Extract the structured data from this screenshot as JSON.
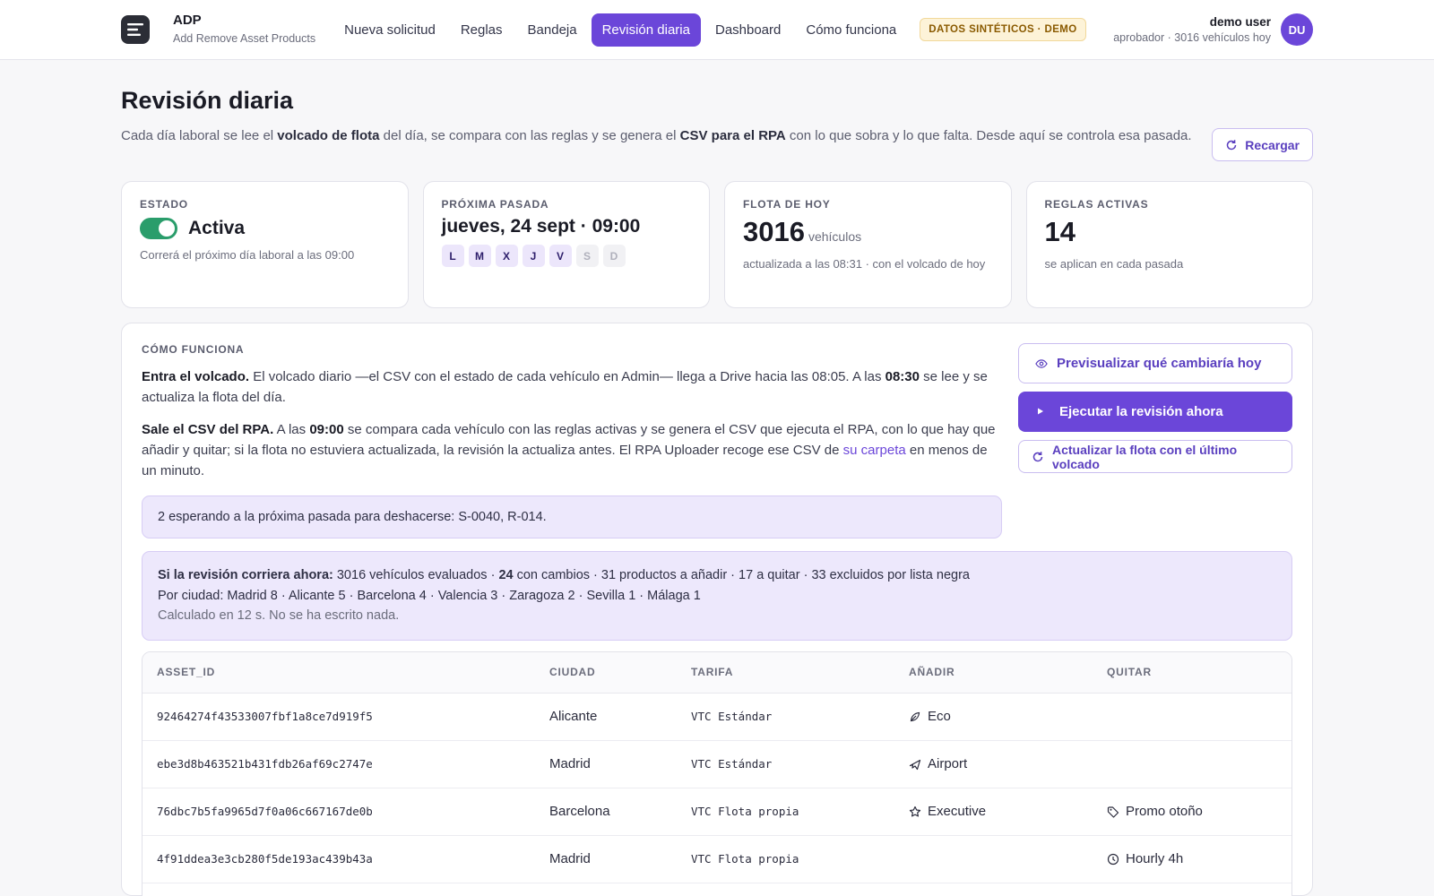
{
  "app": {
    "title": "ADP",
    "subtitle": "Add Remove Asset Products"
  },
  "nav": {
    "items": [
      {
        "label": "Nueva solicitud"
      },
      {
        "label": "Reglas"
      },
      {
        "label": "Bandeja"
      },
      {
        "label": "Revisión diaria",
        "active": true
      },
      {
        "label": "Dashboard"
      },
      {
        "label": "Cómo funciona"
      }
    ],
    "demo_badge": "DATOS SINTÉTICOS · DEMO"
  },
  "user": {
    "name": "demo user",
    "role": "aprobador · 3016 vehículos hoy",
    "initials": "DU"
  },
  "page": {
    "title": "Revisión diaria",
    "intro_1": "Cada día laboral se lee el ",
    "intro_b1": "volcado de flota",
    "intro_2": " del día, se compara con las reglas y se genera el ",
    "intro_b2": "CSV para el RPA",
    "intro_3": " con lo que sobra y lo que falta. Desde aquí se controla esa pasada.",
    "reload_label": "Recargar"
  },
  "cards": {
    "estado": {
      "label": "ESTADO",
      "value": "Activa",
      "sub": "Correrá el próximo día laboral a las 09:00"
    },
    "proxima": {
      "label": "PRÓXIMA PASADA",
      "value": "jueves, 24 sept · 09:00",
      "days": [
        {
          "d": "L",
          "on": true
        },
        {
          "d": "M",
          "on": true
        },
        {
          "d": "X",
          "on": true
        },
        {
          "d": "J",
          "on": true
        },
        {
          "d": "V",
          "on": true
        },
        {
          "d": "S",
          "on": false
        },
        {
          "d": "D",
          "on": false
        }
      ]
    },
    "flota": {
      "label": "FLOTA DE HOY",
      "value": "3016",
      "unit": "vehículos",
      "sub": "actualizada a las 08:31 · con el volcado de hoy"
    },
    "reglas": {
      "label": "REGLAS ACTIVAS",
      "value": "14",
      "sub": "se aplican en cada pasada"
    }
  },
  "how": {
    "label": "CÓMO FUNCIONA",
    "p1_b": "Entra el volcado.",
    "p1_a": " El volcado diario —el CSV con el estado de cada vehículo en Admin— llega a Drive hacia las 08:05. A las ",
    "p1_time": "08:30",
    "p1_c": " se lee y se actualiza la flota del día.",
    "p2_b": "Sale el CSV del RPA.",
    "p2_a": " A las ",
    "p2_time": "09:00",
    "p2_c": " se compara cada vehículo con las reglas activas y se genera el CSV que ejecuta el RPA, con lo que hay que añadir y quitar; si la flota no estuviera actualizada, la revisión la actualiza antes. El RPA Uploader recoge ese CSV de ",
    "p2_link": "su carpeta",
    "p2_d": " en menos de un minuto.",
    "pending": "2 esperando a la próxima pasada para deshacerse: S-0040, R-014.",
    "btn_preview": "Previsualizar qué cambiaría hoy",
    "btn_run": "Ejecutar la revisión ahora",
    "btn_update": "Actualizar la flota con el último volcado"
  },
  "preview": {
    "lead": "Si la revisión corriera ahora:",
    "line1_a": " 3016 vehículos evaluados · ",
    "line1_b": "24",
    "line1_c": " con cambios · 31 productos a añadir · 17 a quitar · 33 excluidos por lista negra",
    "line2": "Por ciudad: Madrid 8 · Alicante 5 · Barcelona 4 · Valencia 3 · Zaragoza 2 · Sevilla 1 · Málaga 1",
    "line3": "Calculado en 12 s. No se ha escrito nada."
  },
  "table": {
    "headers": [
      "ASSET_ID",
      "CIUDAD",
      "TARIFA",
      "AÑADIR",
      "QUITAR"
    ],
    "rows": [
      {
        "asset": "92464274f43533007fbf1a8ce7d919f5",
        "city": "Alicante",
        "tariff": "VTC Estándar",
        "add": "Eco",
        "add_icon": "leaf-icon",
        "remove": "",
        "remove_icon": ""
      },
      {
        "asset": "ebe3d8b463521b431fdb26af69c2747e",
        "city": "Madrid",
        "tariff": "VTC Estándar",
        "add": "Airport",
        "add_icon": "plane-icon",
        "remove": "",
        "remove_icon": ""
      },
      {
        "asset": "76dbc7b5fa9965d7f0a06c667167de0b",
        "city": "Barcelona",
        "tariff": "VTC Flota propia",
        "add": "Executive",
        "add_icon": "star-icon",
        "remove": "Promo otoño",
        "remove_icon": "tag-icon"
      },
      {
        "asset": "4f91ddea3e3cb280f5de193ac439b43a",
        "city": "Madrid",
        "tariff": "VTC Flota propia",
        "add": "",
        "add_icon": "",
        "remove": "Hourly 4h",
        "remove_icon": "clock-icon"
      }
    ]
  },
  "colors": {
    "accent": "#6b46d9",
    "toggle_on": "#2a9d6b",
    "badge_bg": "#fdf3d8"
  }
}
